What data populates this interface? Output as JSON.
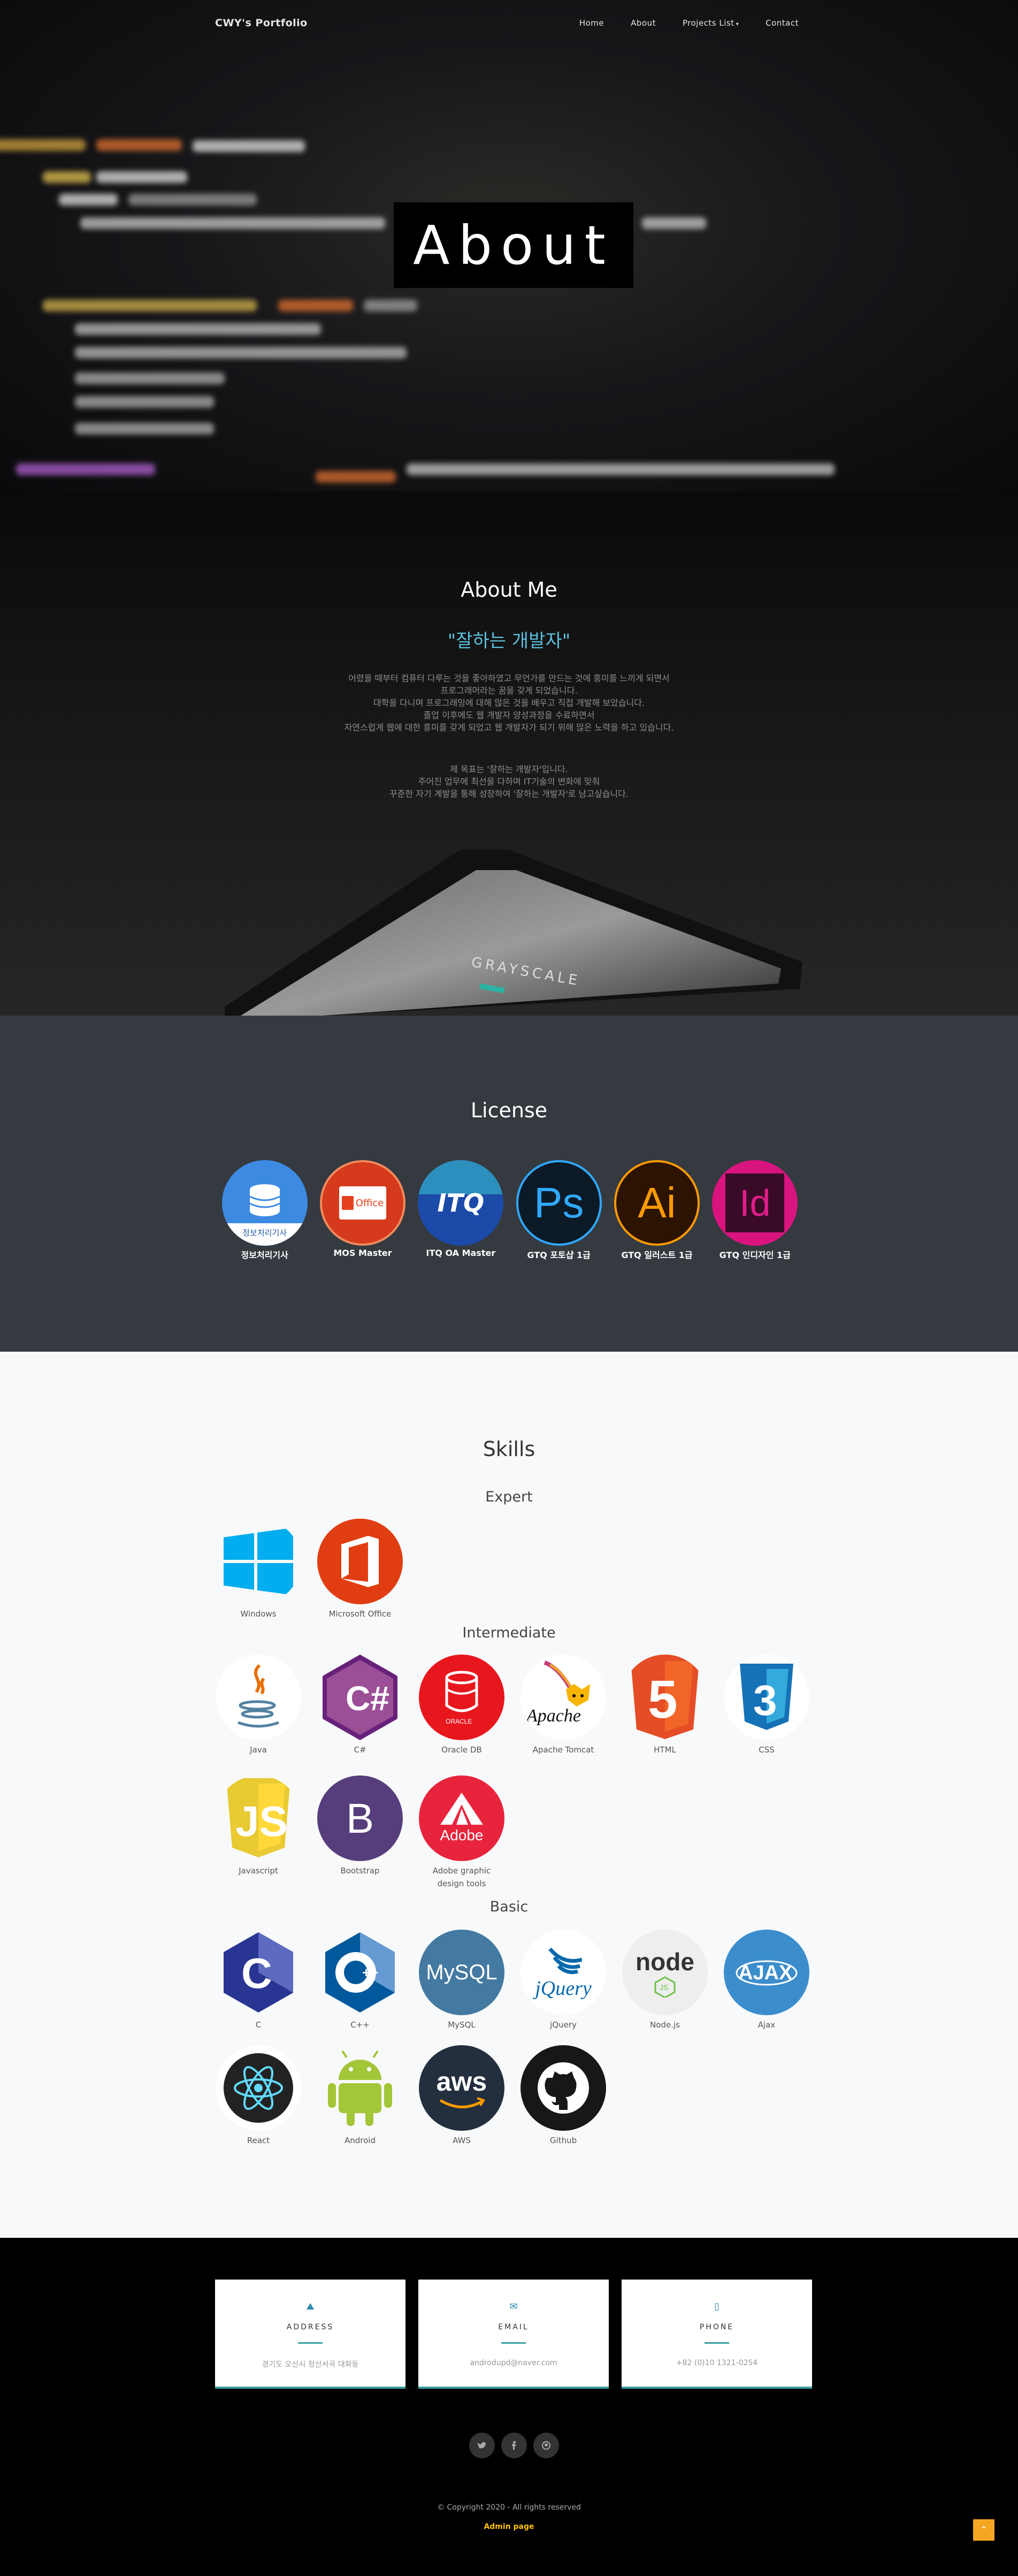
{
  "nav": {
    "brand": "CWY's Portfolio",
    "links": [
      "Home",
      "About",
      "Projects List",
      "Contact"
    ],
    "caret": "▾"
  },
  "hero": {
    "title": "About"
  },
  "about": {
    "title": "About Me",
    "quote": "\"잘하는 개발자\"",
    "paragraph1": [
      "어렸을 때부터 컴퓨터 다루는 것을 좋아하였고 무언가를 만드는 것에 흥미를 느끼게 되면서",
      "프로그래머라는 꿈을 갖게 되었습니다.",
      "대학을 다니며 프로그래밍에 대해 많은 것을 배우고 직접 개발해 보았습니다.",
      "졸업 이후에도 웹 개발자 양성과정을 수료하면서",
      "자연스럽게 웹에 대한 흥미를 갖게 되었고 웹 개발자가 되기 위해 많은 노력을 하고 있습니다."
    ],
    "paragraph2": [
      "제 목표는 '잘하는 개발자'입니다.",
      "주어진 업무에 최선을 다하며 IT기술의 변화에 맞춰",
      "꾸준한 자기 계발을 통해 성장하여 '잘하는 개발자'로 남고싶습니다."
    ],
    "tablet_text": "GRAYSCALE"
  },
  "license": {
    "title": "License",
    "items": [
      {
        "label": "정보처리기사",
        "icon": "database-icon",
        "badge": "정보처리기사"
      },
      {
        "label": "MOS Master",
        "icon": "office-icon",
        "badge": "Office"
      },
      {
        "label": "ITQ OA Master",
        "icon": "itq-icon",
        "badge": "ITQ"
      },
      {
        "label": "GTQ 포토샵 1급",
        "icon": "photoshop-icon",
        "badge": "Ps"
      },
      {
        "label": "GTQ 일러스트 1급",
        "icon": "illustrator-icon",
        "badge": "Ai"
      },
      {
        "label": "GTQ 인디자인 1급",
        "icon": "indesign-icon",
        "badge": "Id"
      }
    ]
  },
  "skills": {
    "title": "Skills",
    "levels": [
      "Expert",
      "Intermediate",
      "Basic"
    ],
    "expert": [
      {
        "label": "Windows",
        "icon": "windows-icon"
      },
      {
        "label": "Microsoft Office",
        "icon": "office-icon"
      }
    ],
    "intermediate": [
      {
        "label": "Java",
        "icon": "java-icon"
      },
      {
        "label": "C#",
        "icon": "csharp-icon",
        "glyph": "C#"
      },
      {
        "label": "Oracle DB",
        "icon": "oracle-icon",
        "glyph": "ORACLE"
      },
      {
        "label": "Apache Tomcat",
        "icon": "tomcat-icon",
        "glyph": "Apache"
      },
      {
        "label": "HTML",
        "icon": "html5-icon",
        "glyph": "5"
      },
      {
        "label": "CSS",
        "icon": "css3-icon",
        "glyph": "3"
      },
      {
        "label": "Javascript",
        "icon": "javascript-icon",
        "glyph": "JS"
      },
      {
        "label": "Bootstrap",
        "icon": "bootstrap-icon",
        "glyph": "B"
      },
      {
        "label": "Adobe graphic design tools",
        "icon": "adobe-icon",
        "glyph": "Adobe"
      }
    ],
    "basic": [
      {
        "label": "C",
        "icon": "c-icon",
        "glyph": "C"
      },
      {
        "label": "C++",
        "icon": "cpp-icon",
        "glyph": "C++"
      },
      {
        "label": "MySQL",
        "icon": "mysql-icon",
        "glyph": "MySQL"
      },
      {
        "label": "jQuery",
        "icon": "jquery-icon",
        "glyph": "jQuery"
      },
      {
        "label": "Node.js",
        "icon": "nodejs-icon",
        "glyph": "node"
      },
      {
        "label": "Ajax",
        "icon": "ajax-icon",
        "glyph": "AJAX"
      },
      {
        "label": "React",
        "icon": "react-icon",
        "glyph": "⚛"
      },
      {
        "label": "Android",
        "icon": "android-icon",
        "glyph": ""
      },
      {
        "label": "AWS",
        "icon": "aws-icon",
        "glyph": "aws"
      },
      {
        "label": "Github",
        "icon": "github-icon",
        "glyph": ""
      }
    ]
  },
  "contact": {
    "cards": [
      {
        "title": "ADDRESS",
        "value": "경기도 오산시 청산서곡 대화동",
        "icon": "map-icon",
        "glyph": "⛰"
      },
      {
        "title": "EMAIL",
        "value": "androdupd@naver.com",
        "icon": "envelope-icon",
        "glyph": "✉"
      },
      {
        "title": "PHONE",
        "value": "+82 (0)10 1321-0254",
        "icon": "mobile-icon",
        "glyph": "▯"
      }
    ],
    "socials": [
      {
        "icon": "twitter-icon",
        "glyph": "🐦"
      },
      {
        "icon": "facebook-icon",
        "glyph": "f"
      },
      {
        "icon": "github-icon",
        "glyph": "◍"
      }
    ],
    "copyright": "© Copyright 2020 - All rights reserved",
    "admin": "Admin page",
    "to_top": "⌃"
  },
  "colors": {
    "accent": "#5bc0de",
    "license_bg": "#343a40",
    "skills_bg": "#f8f9fa",
    "admin_link": "#ffc107"
  }
}
